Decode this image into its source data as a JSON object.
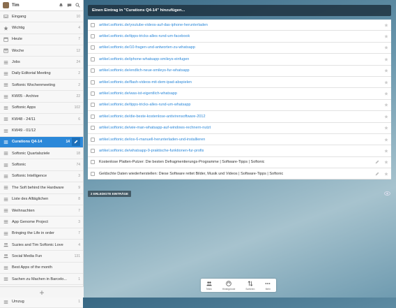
{
  "sidebar": {
    "user": "Tim",
    "header_icons": [
      "bell-icon",
      "chat-icon",
      "search-icon"
    ],
    "items": [
      {
        "label": "Eingang",
        "count": "10",
        "icon": "inbox-icon"
      },
      {
        "label": "Wichtig",
        "count": "4",
        "icon": "star-icon"
      },
      {
        "label": "Heute",
        "count": "7",
        "icon": "calendar-icon"
      },
      {
        "label": "Woche",
        "count": "12",
        "icon": "calendar-week-icon"
      },
      {
        "label": "Jobs",
        "count": "24",
        "icon": "list-icon"
      },
      {
        "label": "Daily Editorial Meeting",
        "count": "2",
        "icon": "list-icon"
      },
      {
        "label": "Softonic Wochenmeeting",
        "count": "2",
        "icon": "list-icon"
      },
      {
        "label": "KW05 - Archive",
        "count": "22",
        "icon": "list-icon"
      },
      {
        "label": "Softonic Apps",
        "count": "102",
        "icon": "list-icon"
      },
      {
        "label": "KW48 - 24/11",
        "count": "6",
        "icon": "list-icon"
      },
      {
        "label": "KW49 - 01/12",
        "count": "",
        "icon": "list-icon"
      },
      {
        "label": "Curations Q4-14",
        "count": "14",
        "icon": "list-icon",
        "active": true
      },
      {
        "label": "Softonic Quartalsziele",
        "count": "18",
        "icon": "list-icon"
      },
      {
        "label": "Softonic",
        "count": "74",
        "icon": "list-icon"
      },
      {
        "label": "Softonic Intelligence",
        "count": "3",
        "icon": "list-icon"
      },
      {
        "label": "The Soft behind the Hardware",
        "count": "9",
        "icon": "list-icon"
      },
      {
        "label": "Liste des Alltäglichen",
        "count": "8",
        "icon": "list-icon"
      },
      {
        "label": "Weihnachten",
        "count": "7",
        "icon": "list-icon"
      },
      {
        "label": "App Genome Project",
        "count": "3",
        "icon": "list-icon"
      },
      {
        "label": "Bringing the Life in order",
        "count": "7",
        "icon": "list-icon"
      },
      {
        "label": "Suzies and Tim Softonic Love",
        "count": "4",
        "icon": "people-icon"
      },
      {
        "label": "Social Media Fun",
        "count": "131",
        "icon": "people-icon"
      },
      {
        "label": "Best Apps of the month",
        "count": "",
        "icon": "list-icon"
      },
      {
        "label": "Sachen zu Machen in Barcelo...",
        "count": "1",
        "icon": "list-icon"
      },
      {
        "label": "Analysen",
        "count": "1",
        "icon": "list-icon"
      },
      {
        "label": "Umzug",
        "count": "1",
        "icon": "list-icon"
      }
    ],
    "footer_add": "+"
  },
  "main": {
    "add_placeholder": "Einen Eintrag in \"Curations Q4-14\" hinzufügen...",
    "tasks": [
      {
        "text": "artikel.softonic.de/youtube-videos-auf-das-iphone-herunterladen",
        "link": true
      },
      {
        "text": "artikel.softonic.de/tipps-tricks-alles-rund-um-facebook",
        "link": true
      },
      {
        "text": "artikel.softonic.de/10-fragen-und-antworten-zu-whatsapp",
        "link": true
      },
      {
        "text": "artikel.softonic.de/iphone-whatsapp-smileys-einfugen",
        "link": true
      },
      {
        "text": "artikel.softonic.de/endlich-neue-smileys-fur-whatsapp",
        "link": true
      },
      {
        "text": "artikel.softonic.de/flash-videos-mit-dem-ipad-abspielen",
        "link": true
      },
      {
        "text": "artikel.softonic.de/was-ist-eigentlich-whatsapp",
        "link": true
      },
      {
        "text": "artikel.softonic.de/tipps-tricks-alles-rund-um-whatsapp",
        "link": true
      },
      {
        "text": "artikel.softonic.de/die-beste-kostenlose-antivirensoftware-2012",
        "link": true
      },
      {
        "text": "artikel.softonic.de/wie-man-whatsapp-auf-windows-rechnern-nutzt",
        "link": true
      },
      {
        "text": "artikel.softonic.de/ios-6-manuell-herunterladen-und-installieren",
        "link": true
      },
      {
        "text": "artikel.softonic.de/whatsapp-9-praktische-funktionen-fur-profis",
        "link": true
      },
      {
        "text": "Kostenlose Platten-Putzer: Die besten Defragmentierungs-Programme | Software-Tipps | Softonic",
        "link": false
      },
      {
        "text": "Geldschte Daten wiederherstellen: Diese Software rettet Bilder, Musik und Videos | Software-Tipps | Softonic",
        "link": false
      }
    ],
    "completed_label": "2 ERLEDIGTE EINTRÄGE"
  },
  "toolbar": [
    {
      "label": "Teilen",
      "icon": "share-people-icon"
    },
    {
      "label": "Hintergründe",
      "icon": "palette-icon"
    },
    {
      "label": "Sortieren",
      "icon": "sort-icon"
    },
    {
      "label": "Mehr",
      "icon": "more-icon"
    }
  ],
  "colors": {
    "accent": "#2b88d9",
    "link": "#2b88d9"
  }
}
